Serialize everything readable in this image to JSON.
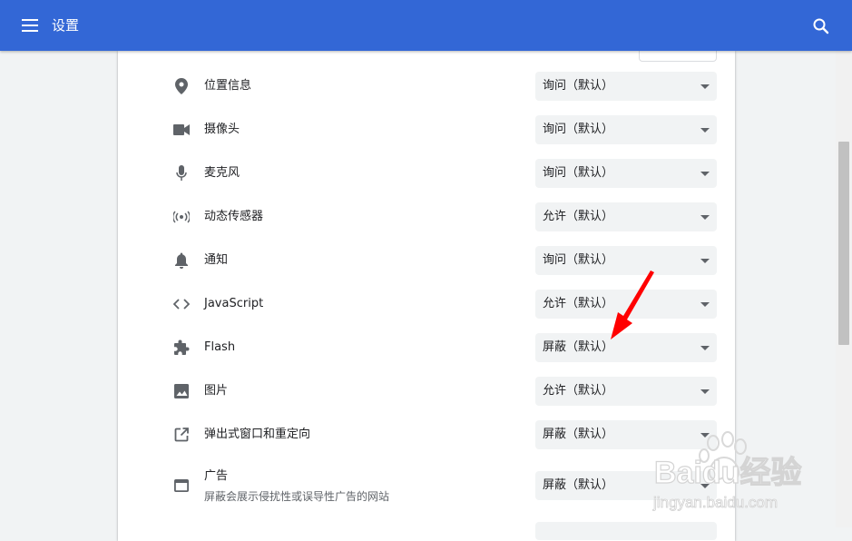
{
  "header": {
    "title": "设置"
  },
  "rows": [
    {
      "icon": "location-pin-icon",
      "label": "位置信息",
      "value": "询问（默认）"
    },
    {
      "icon": "camera-icon",
      "label": "摄像头",
      "value": "询问（默认）"
    },
    {
      "icon": "microphone-icon",
      "label": "麦克风",
      "value": "询问（默认）"
    },
    {
      "icon": "motion-sensor-icon",
      "label": "动态传感器",
      "value": "允许（默认）"
    },
    {
      "icon": "bell-icon",
      "label": "通知",
      "value": "询问（默认）"
    },
    {
      "icon": "code-icon",
      "label": "JavaScript",
      "value": "允许（默认）"
    },
    {
      "icon": "puzzle-icon",
      "label": "Flash",
      "value": "屏蔽（默认）"
    },
    {
      "icon": "image-icon",
      "label": "图片",
      "value": "允许（默认）"
    },
    {
      "icon": "open-in-new-icon",
      "label": "弹出式窗口和重定向",
      "value": "屏蔽（默认）"
    },
    {
      "icon": "ads-window-icon",
      "label": "广告",
      "sublabel": "屏蔽会展示侵扰性或误导性广告的网站",
      "value": "屏蔽（默认）"
    }
  ],
  "watermark": {
    "brand": "Baidu经验",
    "url": "jingyan.baidu.com"
  },
  "colors": {
    "header": "#3367d6",
    "annotation": "#ff0000"
  }
}
